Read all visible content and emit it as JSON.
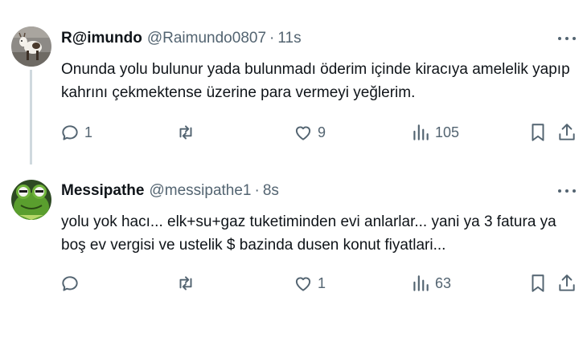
{
  "tweets": [
    {
      "display_name": "R@imundo",
      "handle": "@Raimundo0807",
      "separator": "·",
      "time": "11s",
      "text_lines": [
        "Onunda yolu bulunur yada bulunmadı öderim içinde kiracıya amelelik yapıp",
        "kahrını çekmektense üzerine para vermeyi yeğlerim."
      ],
      "counts": {
        "reply": "1",
        "retweet": "",
        "like": "9",
        "views": "105"
      }
    },
    {
      "display_name": "Messipathe",
      "handle": "@messipathe1",
      "separator": "·",
      "time": "8s",
      "text_lines": [
        "yolu yok hacı... elk+su+gaz tuketiminden evi anlarlar... yani ya 3 fatura ya",
        "boş ev vergisi ve ustelik $ bazinda dusen konut fiyatlari..."
      ],
      "counts": {
        "reply": "",
        "retweet": "",
        "like": "1",
        "views": "63"
      }
    }
  ],
  "icons": {
    "reply": "reply-icon",
    "retweet": "retweet-icon",
    "like": "heart-icon",
    "views": "views-chart-icon",
    "bookmark": "bookmark-icon",
    "share": "share-icon",
    "more": "more-dots-icon"
  },
  "colors": {
    "text": "#0f1419",
    "secondary": "#536471",
    "thread_line": "#cfd9de"
  }
}
